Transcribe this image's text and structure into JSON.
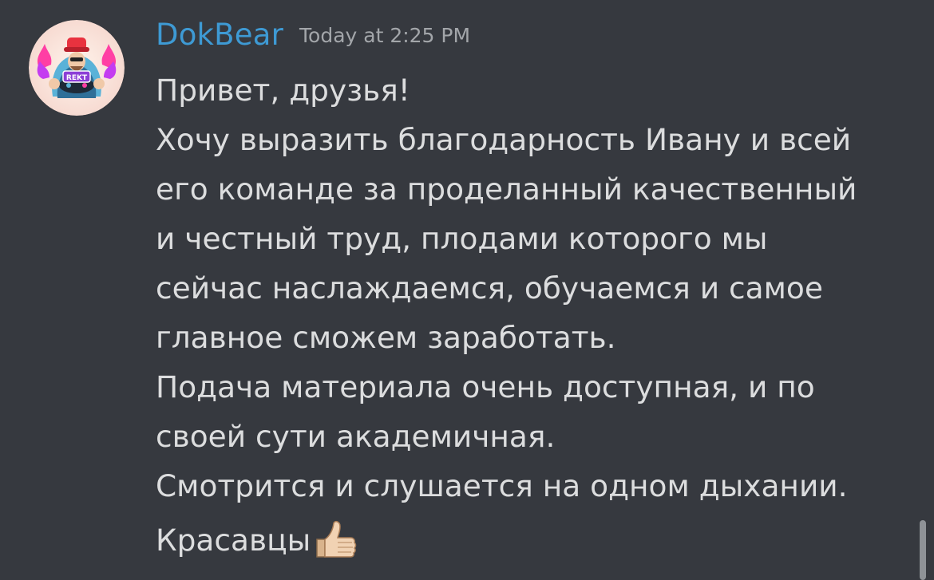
{
  "message": {
    "author": "DokBear",
    "timestamp": "Today at 2:25 PM",
    "avatar_icon": "bear-gamer-avatar-icon",
    "avatar_badge_text": "REKT",
    "lines": [
      "Привет, друзья!",
      "Хочу выразить благодарность Ивану и всей",
      "его команде за проделанный качественный",
      "и честный труд, плодами которого мы",
      "сейчас наслаждаемся, обучаемся и самое",
      "главное сможем заработать.",
      "Подача материала очень доступная, и по",
      "своей сути академичная.",
      "Смотрится и слушается на одном дыхании.",
      "Красавцы"
    ],
    "trailing_emoji": "thumbs-up-icon"
  },
  "colors": {
    "background": "#36393f",
    "author": "#3e9ad4",
    "timestamp": "#a3a6aa",
    "text": "#dcddde"
  }
}
